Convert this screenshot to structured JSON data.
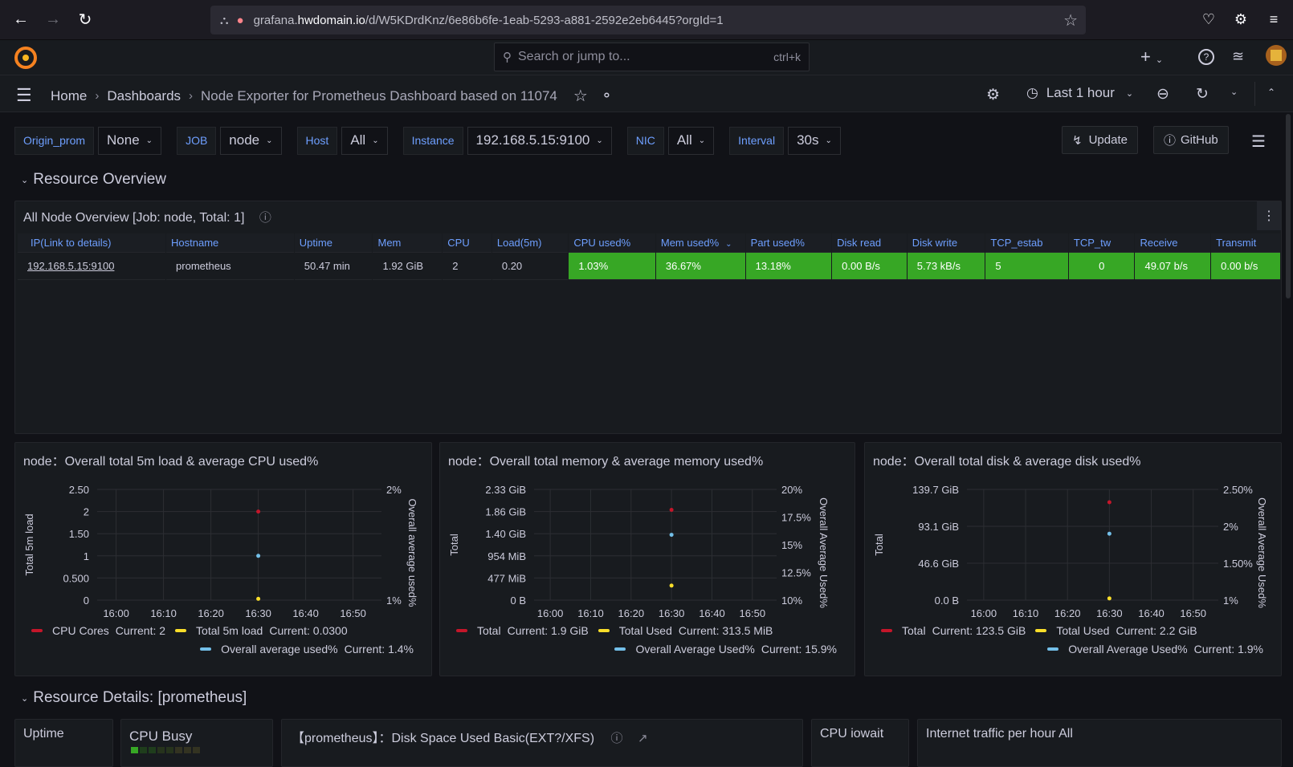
{
  "browser": {
    "url_prefix": "grafana.",
    "url_host": "hwdomain.io",
    "url_path": "/d/W5KDrdKnz/6e86b6fe-1eab-5293-a881-2592e2eb6445?orgId=1"
  },
  "topbar": {
    "search_placeholder": "Search or jump to...",
    "search_shortcut": "ctrl+k",
    "add_label": "+"
  },
  "breadcrumb": [
    "Home",
    "Dashboards",
    "Node Exporter for Prometheus Dashboard based on 11074"
  ],
  "time_picker": "Last 1 hour",
  "variables": [
    {
      "label": "Origin_prom",
      "value": "None"
    },
    {
      "label": "JOB",
      "value": "node"
    },
    {
      "label": "Host",
      "value": "All"
    },
    {
      "label": "Instance",
      "value": "192.168.5.15:9100"
    },
    {
      "label": "NIC",
      "value": "All"
    },
    {
      "label": "Interval",
      "value": "30s"
    }
  ],
  "links": {
    "update": "Update",
    "github": "GitHub"
  },
  "rows": {
    "resource_overview": "Resource Overview",
    "resource_details": "Resource Details: [prometheus]"
  },
  "overview_panel": {
    "title": "All Node Overview [Job: node, Total: 1]",
    "columns": [
      "IP(Link to details)",
      "Hostname",
      "Uptime",
      "Mem",
      "CPU",
      "Load(5m)",
      "CPU used%",
      "Mem used%",
      "Part used%",
      "Disk read",
      "Disk write",
      "TCP_estab",
      "TCP_tw",
      "Receive",
      "Transmit"
    ],
    "rows": [
      [
        "192.168.5.15:9100",
        "prometheus",
        "50.47 min",
        "1.92 GiB",
        "2",
        "0.20",
        "1.03%",
        "36.67%",
        "13.18%",
        "0.00 B/s",
        "5.73 kB/s",
        "5",
        "0",
        "49.07 b/s",
        "0.00 b/s"
      ]
    ],
    "status_color": "#37a725"
  },
  "charts": [
    {
      "title": "node：Overall total 5m load & average CPU used%",
      "left_axis_label": "Total 5m load",
      "right_axis_label": "Overall average used%",
      "left_ticks": [
        "2.50",
        "2",
        "1.50",
        "1",
        "0.500",
        "0"
      ],
      "right_ticks": [
        "2%",
        "1%"
      ],
      "x_ticks": [
        "16:00",
        "16:10",
        "16:20",
        "16:30",
        "16:40",
        "16:50"
      ],
      "legend": [
        {
          "name": "CPU Cores",
          "current": "Current: 2",
          "color": "#c4162a"
        },
        {
          "name": "Total 5m load",
          "current": "Current: 0.0300",
          "color": "#fade2a"
        },
        {
          "name": "Overall average used%",
          "current": "Current: 1.4%",
          "color": "#73bfe8"
        }
      ]
    },
    {
      "title": "node：Overall total memory & average memory used%",
      "left_axis_label": "Total",
      "right_axis_label": "Overall Average Used%",
      "left_ticks": [
        "2.33 GiB",
        "1.86 GiB",
        "1.40 GiB",
        "954 MiB",
        "477 MiB",
        "0 B"
      ],
      "right_ticks": [
        "20%",
        "17.5%",
        "15%",
        "12.5%",
        "10%"
      ],
      "x_ticks": [
        "16:00",
        "16:10",
        "16:20",
        "16:30",
        "16:40",
        "16:50"
      ],
      "legend": [
        {
          "name": "Total",
          "current": "Current: 1.9 GiB",
          "color": "#c4162a"
        },
        {
          "name": "Total Used",
          "current": "Current: 313.5 MiB",
          "color": "#fade2a"
        },
        {
          "name": "Overall Average Used%",
          "current": "Current: 15.9%",
          "color": "#73bfe8"
        }
      ]
    },
    {
      "title": "node：Overall total disk & average disk used%",
      "left_axis_label": "Total",
      "right_axis_label": "Overall Average Used%",
      "left_ticks": [
        "139.7 GiB",
        "93.1 GiB",
        "46.6 GiB",
        "0.0 B"
      ],
      "right_ticks": [
        "2.50%",
        "2%",
        "1.50%",
        "1%"
      ],
      "x_ticks": [
        "16:00",
        "16:10",
        "16:20",
        "16:30",
        "16:40",
        "16:50"
      ],
      "legend": [
        {
          "name": "Total",
          "current": "Current: 123.5 GiB",
          "color": "#c4162a"
        },
        {
          "name": "Total Used",
          "current": "Current: 2.2 GiB",
          "color": "#fade2a"
        },
        {
          "name": "Overall Average Used%",
          "current": "Current: 1.9%",
          "color": "#73bfe8"
        }
      ]
    }
  ],
  "chart_data": [
    {
      "type": "scatter",
      "title": "node：Overall total 5m load & average CPU used%",
      "ylabel": "Total 5m load",
      "y2label": "Overall average used%",
      "ylim": [
        0,
        2.5
      ],
      "y2lim": [
        1,
        2
      ],
      "series": [
        {
          "name": "CPU Cores",
          "x": [
            "16:30"
          ],
          "values": [
            2
          ]
        },
        {
          "name": "Total 5m load",
          "x": [
            "16:30"
          ],
          "values": [
            0.03
          ]
        },
        {
          "name": "Overall average used%",
          "x": [
            "16:30"
          ],
          "values": [
            1.4
          ],
          "axis": "right"
        }
      ]
    },
    {
      "type": "scatter",
      "title": "node：Overall total memory & average memory used%",
      "ylabel": "Total",
      "y2label": "Overall Average Used%",
      "ylim": [
        0,
        2.33
      ],
      "y2lim": [
        10,
        20
      ],
      "series": [
        {
          "name": "Total",
          "x": [
            "16:30"
          ],
          "values": [
            1.9
          ]
        },
        {
          "name": "Total Used",
          "x": [
            "16:30"
          ],
          "values": [
            0.306
          ]
        },
        {
          "name": "Overall Average Used%",
          "x": [
            "16:30"
          ],
          "values": [
            15.9
          ],
          "axis": "right"
        }
      ]
    },
    {
      "type": "scatter",
      "title": "node：Overall total disk & average disk used%",
      "ylabel": "Total",
      "y2label": "Overall Average Used%",
      "ylim": [
        0,
        139.7
      ],
      "y2lim": [
        1,
        2.5
      ],
      "series": [
        {
          "name": "Total",
          "x": [
            "16:30"
          ],
          "values": [
            123.5
          ]
        },
        {
          "name": "Total Used",
          "x": [
            "16:30"
          ],
          "values": [
            2.2
          ]
        },
        {
          "name": "Overall Average Used%",
          "x": [
            "16:30"
          ],
          "values": [
            1.9
          ],
          "axis": "right"
        }
      ]
    }
  ],
  "bottom_panels": {
    "uptime": "Uptime",
    "cpu_busy": "CPU Busy",
    "disk_space": "【prometheus】：Disk Space Used Basic(EXT?/XFS)",
    "cpu_iowait": "CPU iowait",
    "internet_traffic": "Internet traffic per hour All"
  }
}
